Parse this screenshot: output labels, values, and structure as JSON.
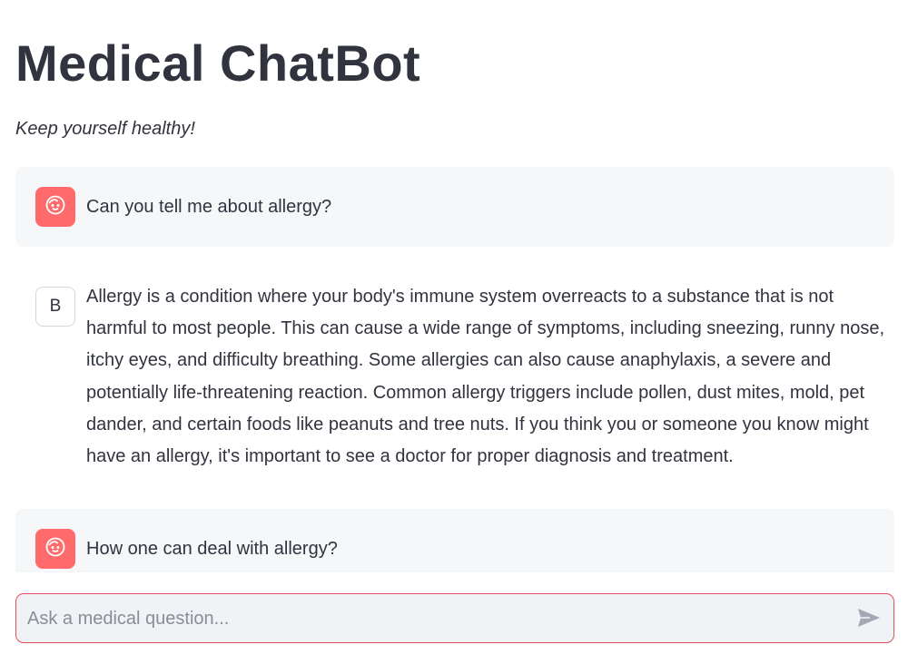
{
  "header": {
    "title": "Medical ChatBot",
    "subtitle": "Keep yourself healthy!"
  },
  "messages": [
    {
      "role": "user",
      "avatar_icon": "baby-face-icon",
      "text": "Can you tell me about allergy?"
    },
    {
      "role": "assistant",
      "avatar_letter": "B",
      "text": "Allergy is a condition where your body's immune system overreacts to a substance that is not harmful to most people. This can cause a wide range of symptoms, including sneezing, runny nose, itchy eyes, and difficulty breathing. Some allergies can also cause anaphylaxis, a severe and potentially life-threatening reaction. Common allergy triggers include pollen, dust mites, mold, pet dander, and certain foods like peanuts and tree nuts. If you think you or someone you know might have an allergy, it's important to see a doctor for proper diagnosis and treatment."
    },
    {
      "role": "user",
      "avatar_icon": "baby-face-icon",
      "text": "How one can deal with allergy?"
    }
  ],
  "chat_input": {
    "placeholder": "Ask a medical question...",
    "value": "",
    "send_icon": "send-arrow-icon"
  },
  "colors": {
    "user_avatar": "#ff6b6b",
    "input_border": "#e5505a",
    "user_message_bg": "#f6f7f9",
    "text": "#31333f"
  }
}
